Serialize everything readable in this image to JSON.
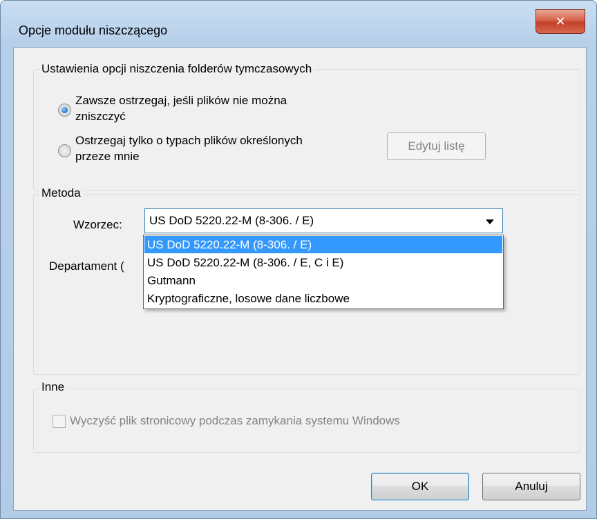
{
  "window": {
    "title": "Opcje modułu niszczącego",
    "close_glyph": "✕"
  },
  "temp_group": {
    "title": "Ustawienia opcji niszczenia folderów tymczasowych",
    "option_always": "Zawsze ostrzegaj, jeśli plików nie można zniszczyć",
    "option_always_line1": "Zawsze ostrzegaj, jeśli plików nie można",
    "option_always_line2": "zniszczyć",
    "option_types_line1": "Ostrzegaj tylko o typach plików określonych",
    "option_types_line2": "przeze mnie",
    "selected_option": "always",
    "edit_list_label": "Edytuj listę"
  },
  "method_group": {
    "title": "Metoda",
    "pattern_label": "Wzorzec:",
    "pattern_value": "US DoD 5220.22-M (8-306. / E)",
    "department_label_partial": "Departament (",
    "options": [
      "US DoD 5220.22-M (8-306. / E)",
      "US DoD 5220.22-M (8-306. / E, C i E)",
      "Gutmann",
      "Kryptograficzne, losowe dane liczbowe"
    ],
    "selected_index": 0
  },
  "other_group": {
    "title": "Inne",
    "pagefile_checkbox_label": "Wyczyść plik stronicowy podczas zamykania systemu Windows",
    "pagefile_checked": false
  },
  "buttons": {
    "ok": "OK",
    "cancel": "Anuluj"
  },
  "colors": {
    "selection": "#3399ff",
    "close_button": "#c2412a",
    "window_frame": "#b7d0ea"
  }
}
